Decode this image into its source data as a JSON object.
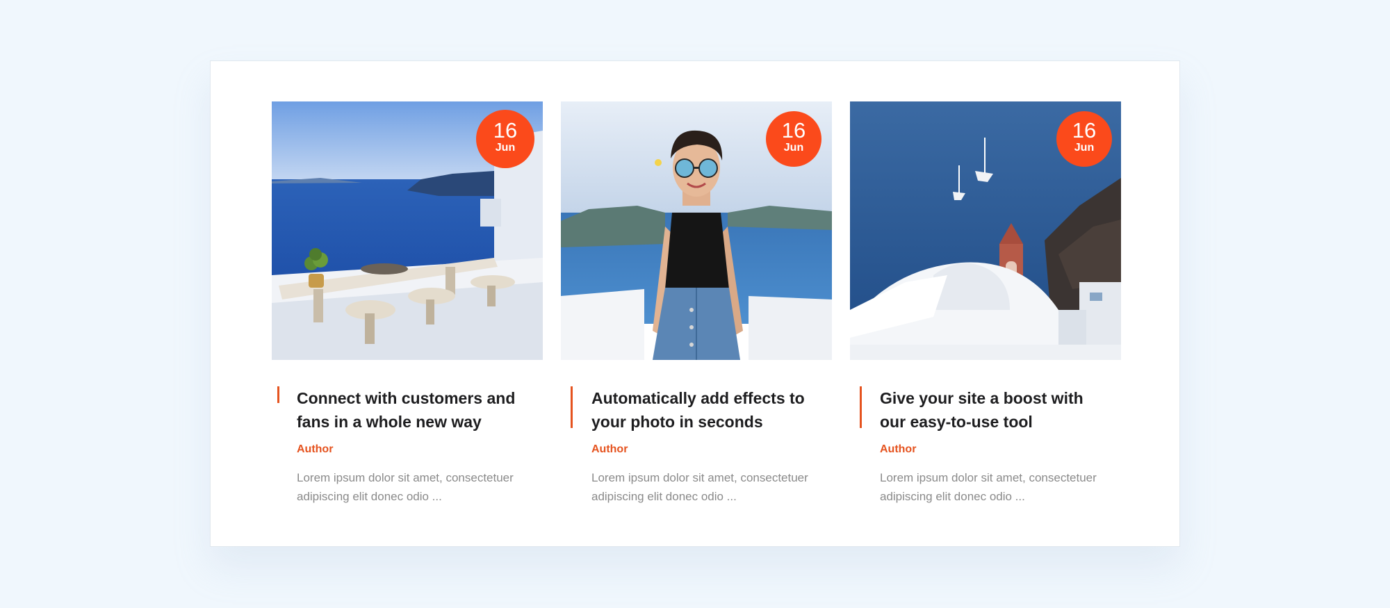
{
  "colors": {
    "background": "#f0f7fd",
    "panel": "#ffffff",
    "accent": "#fb4a1b",
    "accent_line": "#e5531f",
    "title_text": "#1d1d1f",
    "body_text": "#8a8a8a"
  },
  "cards": [
    {
      "image": "terrace-sea-view-image",
      "date": {
        "day": "16",
        "month": "Jun"
      },
      "title": "Connect with customers and fans in a whole new way",
      "author": "Author",
      "excerpt": "Lorem ipsum dolor sit amet, consectetuer adipiscing elit donec odio ..."
    },
    {
      "image": "woman-sunglasses-image",
      "date": {
        "day": "16",
        "month": "Jun"
      },
      "title": "Automatically add effects to your photo in seconds",
      "author": "Author",
      "excerpt": "Lorem ipsum dolor sit amet, consectetuer adipiscing elit donec odio ..."
    },
    {
      "image": "santorini-boats-image",
      "date": {
        "day": "16",
        "month": "Jun"
      },
      "title": "Give your site a boost with our easy-to-use tool",
      "author": "Author",
      "excerpt": "Lorem ipsum dolor sit amet, consectetuer adipiscing elit donec odio ..."
    }
  ]
}
